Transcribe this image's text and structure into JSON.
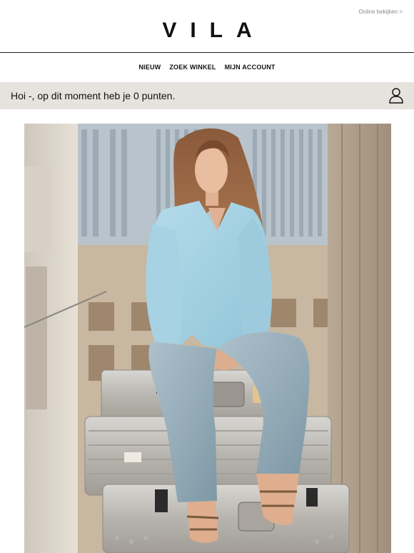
{
  "header": {
    "online_link": "Online bekijken >",
    "logo": "VILA"
  },
  "nav": {
    "items": [
      "NIEUW",
      "ZOEK WINKEL",
      "MIJN ACCOUNT"
    ]
  },
  "points": {
    "message": "Hoi -, op dit moment heb je 0 punten.",
    "icon": "user-icon"
  },
  "hero": {
    "icon": "hero-photo"
  }
}
